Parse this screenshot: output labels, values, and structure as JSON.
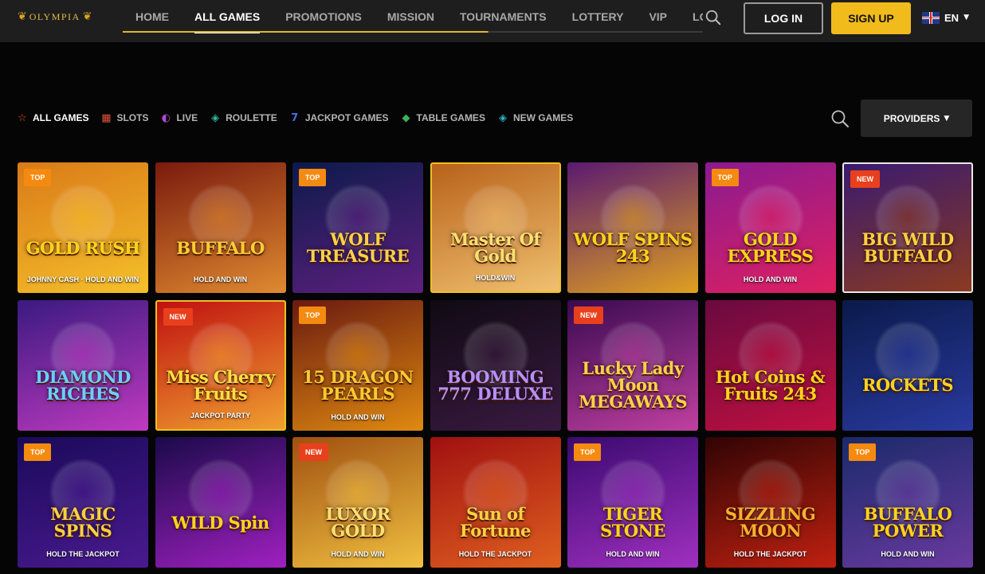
{
  "brand": {
    "name": "OLYMPIA"
  },
  "nav": {
    "items": [
      {
        "label": "HOME",
        "active": false
      },
      {
        "label": "ALL GAMES",
        "active": true
      },
      {
        "label": "PROMOTIONS",
        "active": false
      },
      {
        "label": "MISSION",
        "active": false
      },
      {
        "label": "TOURNAMENTS",
        "active": false
      },
      {
        "label": "LOTTERY",
        "active": false
      },
      {
        "label": "VIP",
        "active": false
      },
      {
        "label": "LOYA",
        "active": false
      }
    ]
  },
  "auth": {
    "login_label": "LOG IN",
    "signup_label": "SIGN UP"
  },
  "language": {
    "code": "EN",
    "flag_icon": "uk-flag-icon"
  },
  "categories": [
    {
      "label": "ALL GAMES",
      "icon": "star-icon",
      "glyph": "☆",
      "color": "#e35a2a",
      "active": true
    },
    {
      "label": "SLOTS",
      "icon": "slot-machine-icon",
      "glyph": "▦",
      "color": "#e0523a",
      "active": false
    },
    {
      "label": "LIVE",
      "icon": "live-dealer-icon",
      "glyph": "◐",
      "color": "#b04ad0",
      "active": false
    },
    {
      "label": "ROULETTE",
      "icon": "roulette-icon",
      "glyph": "◈",
      "color": "#2fb89a",
      "active": false
    },
    {
      "label": "JACKPOT GAMES",
      "icon": "jackpot-7-icon",
      "glyph": "7",
      "color": "#4a6ee0",
      "active": false
    },
    {
      "label": "TABLE GAMES",
      "icon": "cards-icon",
      "glyph": "◆",
      "color": "#3fb05a",
      "active": false
    },
    {
      "label": "NEW GAMES",
      "icon": "new-games-icon",
      "glyph": "◈",
      "color": "#2fb0c0",
      "active": false
    }
  ],
  "providers": {
    "label": "PROVIDERS"
  },
  "badge_colors": {
    "TOP": "#f58a10",
    "NEW": "#e8401c"
  },
  "games": [
    {
      "name": "GOLD RUSH",
      "sub": "JOHNNY CASH · HOLD AND WIN",
      "badge": "TOP",
      "bg": [
        "#d97a18",
        "#f5c02a"
      ],
      "text": "#ffd21e"
    },
    {
      "name": "BUFFALO",
      "sub": "HOLD AND WIN",
      "badge": "",
      "bg": [
        "#7a1a0e",
        "#e08a30"
      ],
      "text": "#ffcc33"
    },
    {
      "name": "WOLF TREASURE",
      "sub": "",
      "badge": "TOP",
      "bg": [
        "#0c1a4a",
        "#5e2080"
      ],
      "text": "#ffd04a"
    },
    {
      "name": "Master Of Gold",
      "sub": "HOLD&WIN",
      "badge": "",
      "bg": [
        "#b8621a",
        "#f0c070"
      ],
      "text": "#ffe070",
      "border": "gold"
    },
    {
      "name": "WOLF SPINS 243",
      "sub": "",
      "badge": "",
      "bg": [
        "#5a1a70",
        "#e0a020"
      ],
      "text": "#ffd21e"
    },
    {
      "name": "GOLD EXPRESS",
      "sub": "HOLD AND WIN",
      "badge": "TOP",
      "bg": [
        "#8a1a90",
        "#e02060"
      ],
      "text": "#ffd21e"
    },
    {
      "name": "BIG WILD BUFFALO",
      "sub": "",
      "badge": "NEW",
      "bg": [
        "#3a1a70",
        "#8a3a20"
      ],
      "text": "#ffd040",
      "border": "white"
    },
    {
      "name": "DIAMOND RICHES",
      "sub": "",
      "badge": "",
      "bg": [
        "#3a1a80",
        "#c03ac0"
      ],
      "text": "#6ad0ff"
    },
    {
      "name": "Miss Cherry Fruits",
      "sub": "JACKPOT PARTY",
      "badge": "NEW",
      "bg": [
        "#c01010",
        "#f0a030"
      ],
      "text": "#ffe040",
      "border": "gold"
    },
    {
      "name": "15 DRAGON PEARLS",
      "sub": "HOLD AND WIN",
      "badge": "TOP",
      "bg": [
        "#6a1a10",
        "#e08a10"
      ],
      "text": "#ffc830"
    },
    {
      "name": "BOOMING 777 DELUXE",
      "sub": "",
      "badge": "",
      "bg": [
        "#100a14",
        "#3a1a40"
      ],
      "text": "#b890ff"
    },
    {
      "name": "Lucky Lady Moon MEGAWAYS",
      "sub": "",
      "badge": "NEW",
      "bg": [
        "#3a0a50",
        "#c040a0"
      ],
      "text": "#ffd04a"
    },
    {
      "name": "Hot Coins & Fruits 243",
      "sub": "",
      "badge": "",
      "bg": [
        "#6a0a40",
        "#c01040"
      ],
      "text": "#ffd21e"
    },
    {
      "name": "ROCKETS",
      "sub": "",
      "badge": "",
      "bg": [
        "#0a1a4a",
        "#2a3aa0"
      ],
      "text": "#ffd21e"
    },
    {
      "name": "MAGIC SPINS",
      "sub": "HOLD THE JACKPOT",
      "badge": "TOP",
      "bg": [
        "#1a0a5a",
        "#4a1a90"
      ],
      "text": "#ffd040"
    },
    {
      "name": "WILD Spin",
      "sub": "",
      "badge": "",
      "bg": [
        "#1a0a4a",
        "#a020c0"
      ],
      "text": "#ffd21e"
    },
    {
      "name": "LUXOR GOLD",
      "sub": "HOLD AND WIN",
      "badge": "NEW",
      "bg": [
        "#a05010",
        "#f0c040"
      ],
      "text": "#ffe070"
    },
    {
      "name": "Sun of Fortune",
      "sub": "HOLD THE JACKPOT",
      "badge": "",
      "bg": [
        "#a01010",
        "#e06020"
      ],
      "text": "#ffd040"
    },
    {
      "name": "TIGER STONE",
      "sub": "HOLD AND WIN",
      "badge": "TOP",
      "bg": [
        "#3a0a70",
        "#a030c0"
      ],
      "text": "#ffd21e"
    },
    {
      "name": "SIZZLING MOON",
      "sub": "HOLD THE JACKPOT",
      "badge": "",
      "bg": [
        "#300404",
        "#c02010"
      ],
      "text": "#ffb030"
    },
    {
      "name": "BUFFALO POWER",
      "sub": "HOLD AND WIN",
      "badge": "TOP",
      "bg": [
        "#1a2a6a",
        "#6a3aa0"
      ],
      "text": "#ffd21e"
    }
  ]
}
